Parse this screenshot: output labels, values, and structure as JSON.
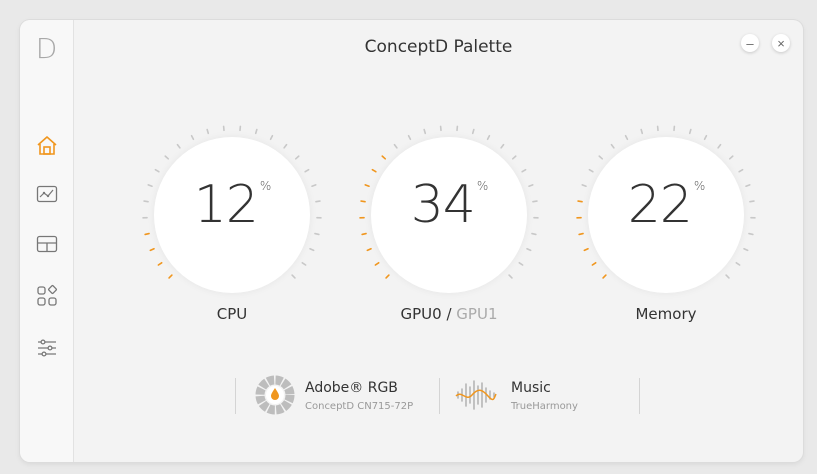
{
  "app": {
    "title": "ConceptD Palette",
    "logo_letter": "D"
  },
  "window_controls": {
    "minimize": "–",
    "close": "×"
  },
  "sidebar": {
    "items": [
      {
        "name": "home",
        "active": true
      },
      {
        "name": "color-profiles",
        "active": false
      },
      {
        "name": "layout",
        "active": false
      },
      {
        "name": "apps",
        "active": false
      },
      {
        "name": "settings",
        "active": false
      }
    ]
  },
  "gauges": [
    {
      "value": "12",
      "unit": "%",
      "label": "CPU",
      "percent": 12
    },
    {
      "value": "34",
      "unit": "%",
      "label_primary": "GPU0",
      "label_sep": " / ",
      "label_secondary": "GPU1",
      "percent": 34
    },
    {
      "value": "22",
      "unit": "%",
      "label": "Memory",
      "percent": 22
    }
  ],
  "profiles": {
    "color": {
      "title": "Adobe® RGB",
      "subtitle": "ConceptD CN715-72P"
    },
    "audio": {
      "title": "Music",
      "subtitle": "TrueHarmony"
    }
  },
  "colors": {
    "accent": "#f0961e",
    "tick_inactive": "#c8c8c8",
    "text": "#333333"
  }
}
